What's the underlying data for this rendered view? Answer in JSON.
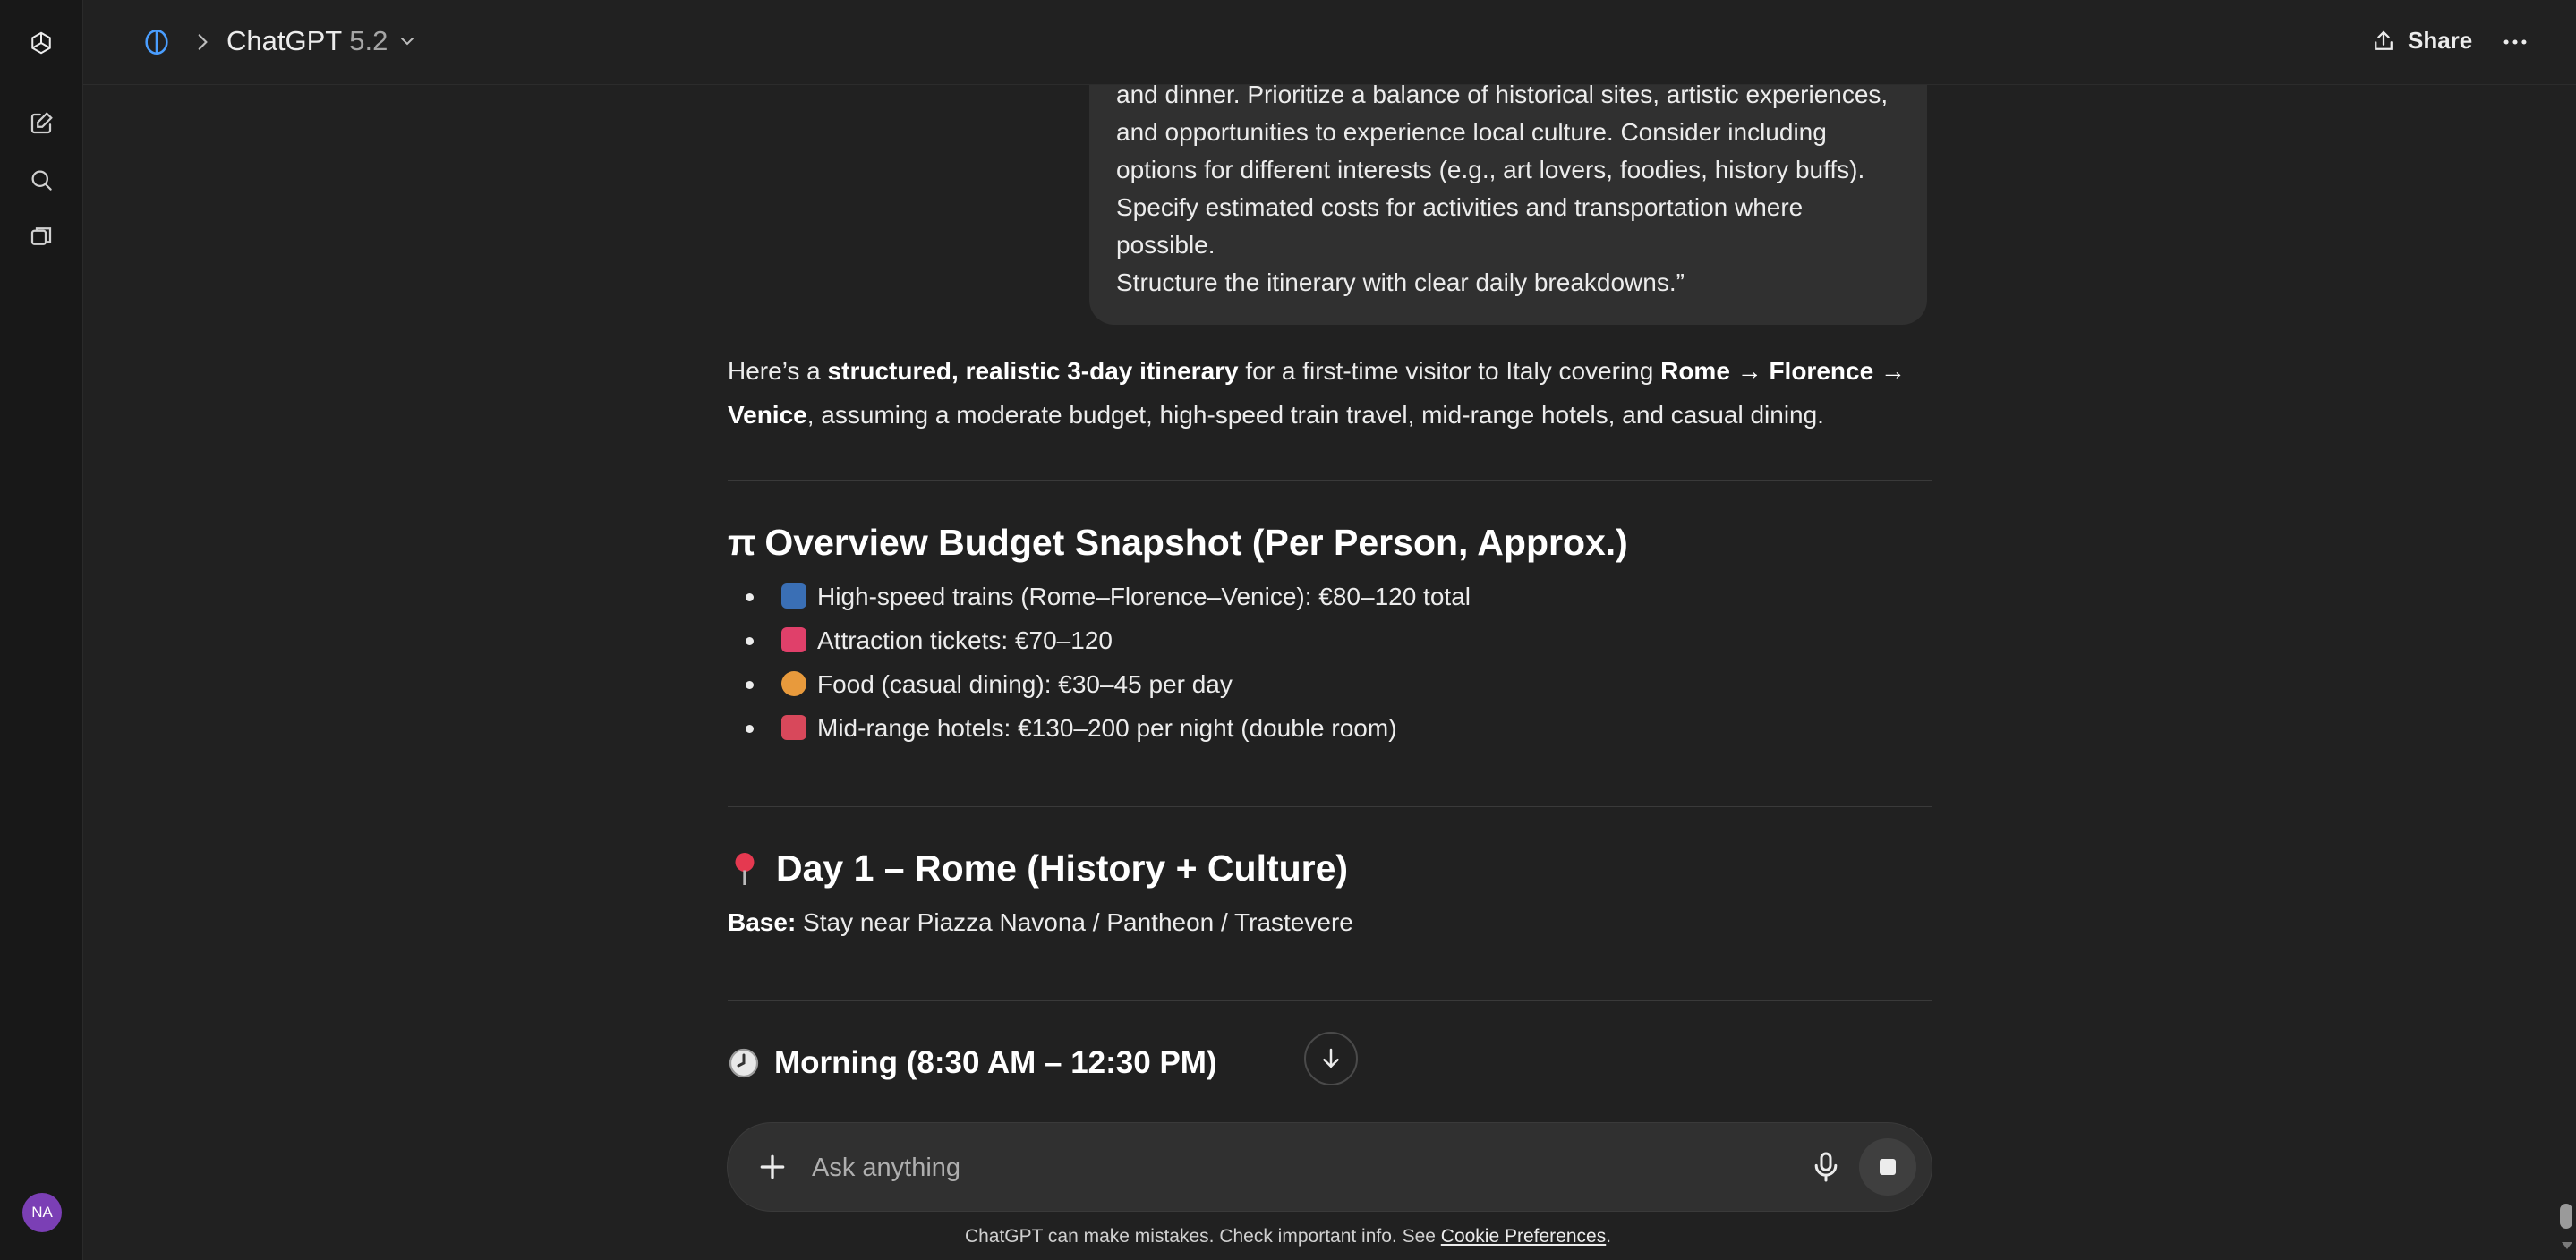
{
  "header": {
    "model_name": "ChatGPT",
    "model_version": "5.2",
    "share_label": "Share"
  },
  "sidebar": {
    "avatar_initials": "NA"
  },
  "user_message": {
    "lines": [
      "and dinner. Prioritize a balance of historical sites, artistic experiences,",
      "and opportunities to experience local culture. Consider including",
      "options for different interests (e.g., art lovers, foodies, history buffs).",
      "Specify estimated costs for activities and transportation where possible.",
      "Structure the itinerary with clear daily breakdowns.”"
    ]
  },
  "response": {
    "intro": {
      "t1": "Here’s a ",
      "b1": "structured, realistic 3-day itinerary",
      "t2": " for a first-time visitor to Italy covering ",
      "b2": "Rome → Florence →",
      "b3": "Venice",
      "t3": ", assuming a moderate budget, high-speed train travel, mid-range hotels, and casual dining."
    },
    "budget": {
      "icon": "π",
      "heading": "Overview Budget Snapshot (Per Person, Approx.)",
      "items": [
        "High-speed trains (Rome–Florence–Venice): €80–120 total",
        "Attraction tickets: €70–120",
        "Food (casual dining): €30–45 per day",
        "Mid-range hotels: €130–200 per night (double room)"
      ]
    },
    "day1": {
      "heading": "Day 1 – Rome (History + Culture)",
      "base_label": "Base:",
      "base_value": " Stay near Piazza Navona / Pantheon / Trastevere"
    },
    "morning": {
      "heading": "Morning (8:30 AM – 12:30 PM)"
    }
  },
  "composer": {
    "placeholder": "Ask anything"
  },
  "footer": {
    "disclaimer": "ChatGPT can make mistakes. Check important info. See ",
    "link": "Cookie Preferences",
    "end": "."
  },
  "colors": {
    "background": "#212121",
    "sidebar": "#181818",
    "bubble": "#303030",
    "avatar": "#7b3fb5",
    "accent_blue": "#4a9eff"
  },
  "icons": [
    "openai-logo-icon",
    "new-chat-icon",
    "search-icon",
    "library-icon",
    "temporary-chat-icon",
    "chevron-right-icon",
    "chevron-down-icon",
    "share-icon",
    "more-icon",
    "train-icon",
    "ticket-icon",
    "food-icon",
    "hotel-icon",
    "pin-icon",
    "clock-icon",
    "arrow-down-icon",
    "plus-icon",
    "mic-icon",
    "stop-icon"
  ]
}
